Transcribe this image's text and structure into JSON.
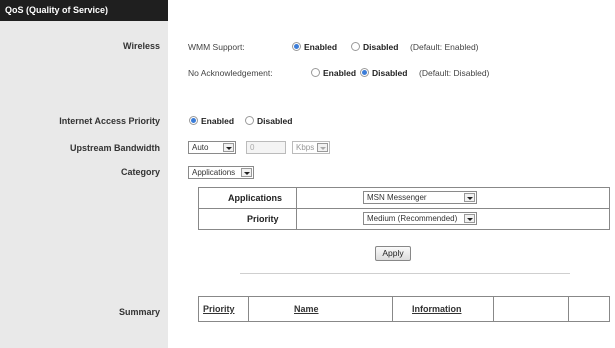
{
  "sidebar": {
    "header": "QoS (Quality of Service)",
    "labels": {
      "wireless": "Wireless",
      "internet_access_priority": "Internet Access Priority",
      "upstream_bandwidth": "Upstream Bandwidth",
      "category": "Category",
      "summary": "Summary"
    }
  },
  "wireless": {
    "wmm": {
      "label": "WMM Support:",
      "enabled": "Enabled",
      "disabled": "Disabled",
      "default": "(Default: Enabled)",
      "selected": "Enabled"
    },
    "no_ack": {
      "label": "No Acknowledgement:",
      "enabled": "Enabled",
      "disabled": "Disabled",
      "default": "(Default: Disabled)",
      "selected": "Disabled"
    }
  },
  "internet_priority": {
    "enabled": "Enabled",
    "disabled": "Disabled",
    "selected": "Enabled"
  },
  "upstream": {
    "mode": "Auto",
    "value": "0",
    "unit": "Kbps"
  },
  "category": {
    "selected": "Applications"
  },
  "app_table": {
    "applications_label": "Applications",
    "applications_value": "MSN Messenger",
    "priority_label": "Priority",
    "priority_value": "Medium (Recommended)",
    "apply_label": "Apply"
  },
  "summary": {
    "columns": [
      "Priority",
      "Name",
      "Information"
    ]
  }
}
